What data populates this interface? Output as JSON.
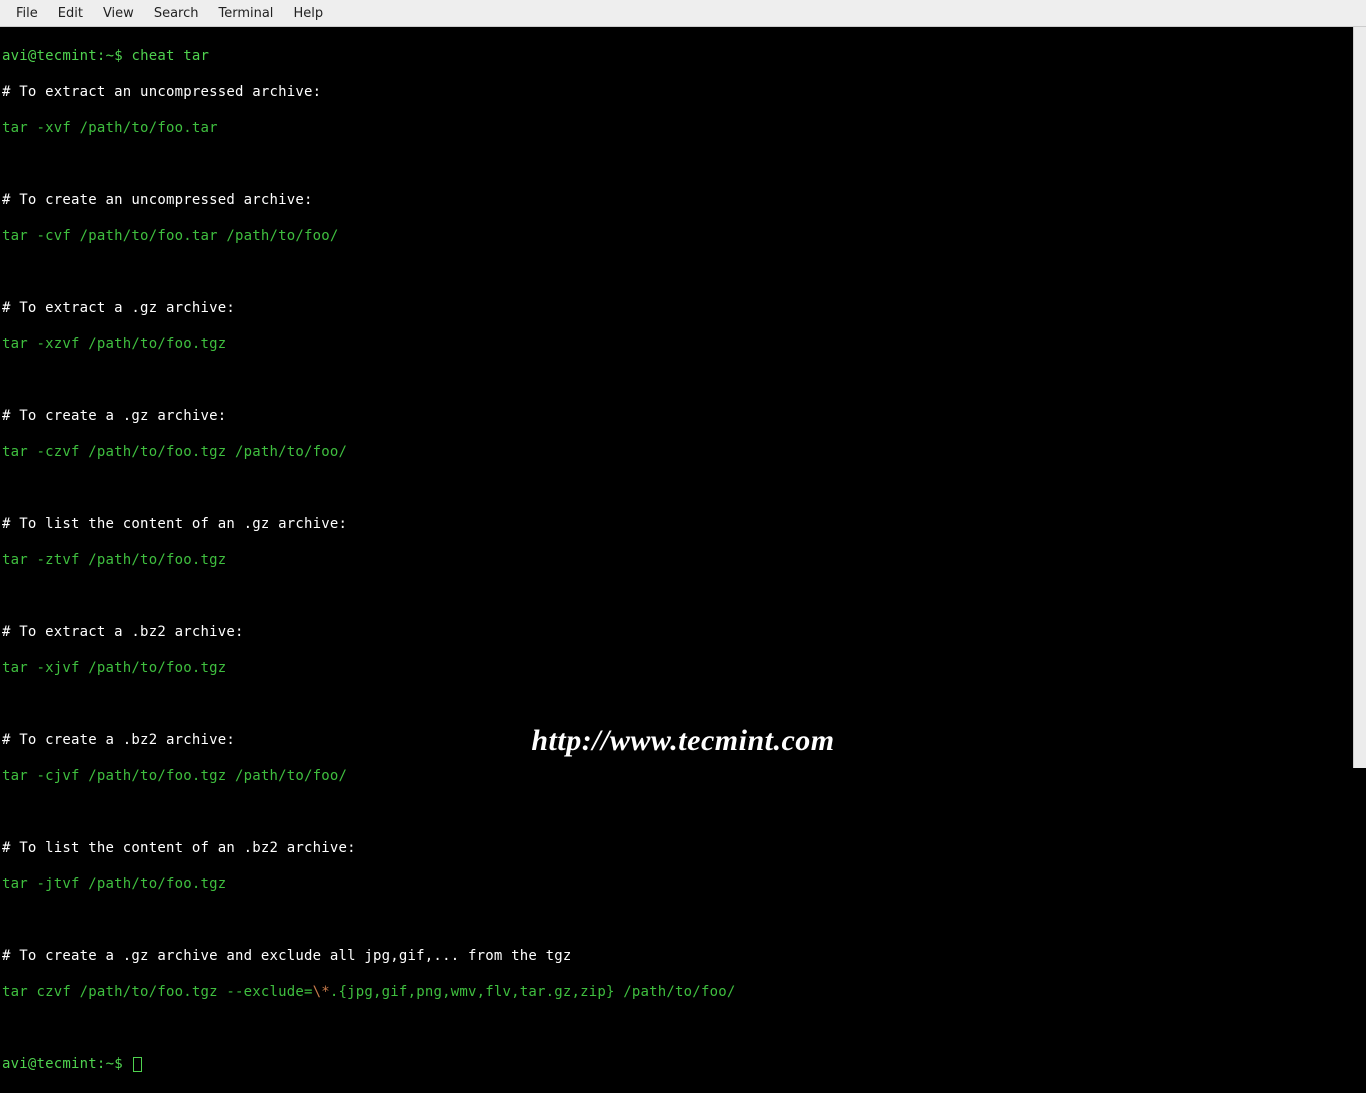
{
  "menubar": {
    "items": [
      {
        "label": "File"
      },
      {
        "label": "Edit"
      },
      {
        "label": "View"
      },
      {
        "label": "Search"
      },
      {
        "label": "Terminal"
      },
      {
        "label": "Help"
      }
    ]
  },
  "prompt": {
    "user_host": "avi@tecmint",
    "sep": ":",
    "path": "~",
    "symbol": "$"
  },
  "command": "cheat tar",
  "output": {
    "sections": [
      {
        "comment": "# To extract an uncompressed archive:",
        "cmd_pre": "tar -xvf /path/to/foo.tar",
        "esc": "",
        "cmd_post": ""
      },
      {
        "comment": "# To create an uncompressed archive:",
        "cmd_pre": "tar -cvf /path/to/foo.tar /path/to/foo/",
        "esc": "",
        "cmd_post": ""
      },
      {
        "comment": "# To extract a .gz archive:",
        "cmd_pre": "tar -xzvf /path/to/foo.tgz",
        "esc": "",
        "cmd_post": ""
      },
      {
        "comment": "# To create a .gz archive:",
        "cmd_pre": "tar -czvf /path/to/foo.tgz /path/to/foo/",
        "esc": "",
        "cmd_post": ""
      },
      {
        "comment": "# To list the content of an .gz archive:",
        "cmd_pre": "tar -ztvf /path/to/foo.tgz",
        "esc": "",
        "cmd_post": ""
      },
      {
        "comment": "# To extract a .bz2 archive:",
        "cmd_pre": "tar -xjvf /path/to/foo.tgz",
        "esc": "",
        "cmd_post": ""
      },
      {
        "comment": "# To create a .bz2 archive:",
        "cmd_pre": "tar -cjvf /path/to/foo.tgz /path/to/foo/",
        "esc": "",
        "cmd_post": ""
      },
      {
        "comment": "# To list the content of an .bz2 archive:",
        "cmd_pre": "tar -jtvf /path/to/foo.tgz",
        "esc": "",
        "cmd_post": ""
      },
      {
        "comment": "# To create a .gz archive and exclude all jpg,gif,... from the tgz",
        "cmd_pre": "tar czvf /path/to/foo.tgz --exclude=",
        "esc": "\\*",
        "cmd_post": ".{jpg,gif,png,wmv,flv,tar.gz,zip} /path/to/foo/"
      }
    ]
  },
  "watermark": "http://www.tecmint.com"
}
